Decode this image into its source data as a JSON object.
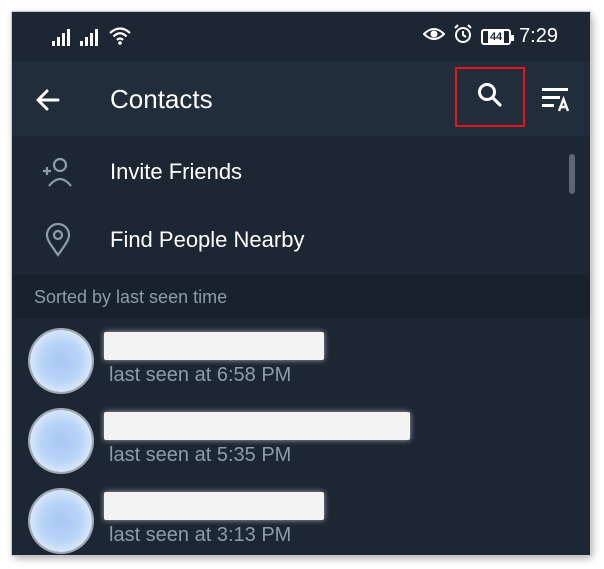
{
  "status_bar": {
    "time": "7:29",
    "battery_level": "44",
    "icons": [
      "signal-icon",
      "signal-icon",
      "wifi-icon",
      "eye-icon",
      "alarm-icon",
      "battery-icon"
    ]
  },
  "app_bar": {
    "title": "Contacts",
    "back_icon": "arrow-left-icon",
    "search_icon": "search-icon",
    "sort_icon": "sort-alpha-icon",
    "highlight_color": "#e2151c"
  },
  "menu": {
    "items": [
      {
        "label": "Invite Friends",
        "icon": "add-person-icon"
      },
      {
        "label": "Find People Nearby",
        "icon": "location-pin-icon"
      }
    ]
  },
  "section": {
    "header": "Sorted by last seen time"
  },
  "contacts": [
    {
      "name": "",
      "status": "last seen at 6:58 PM"
    },
    {
      "name": "",
      "status": "last seen at 5:35 PM"
    },
    {
      "name": "",
      "status": "last seen at 3:13 PM"
    }
  ],
  "colors": {
    "background": "#1d2733",
    "app_bar": "#212d3b",
    "section_header": "#18222d",
    "secondary_text": "#8e9ba8"
  }
}
